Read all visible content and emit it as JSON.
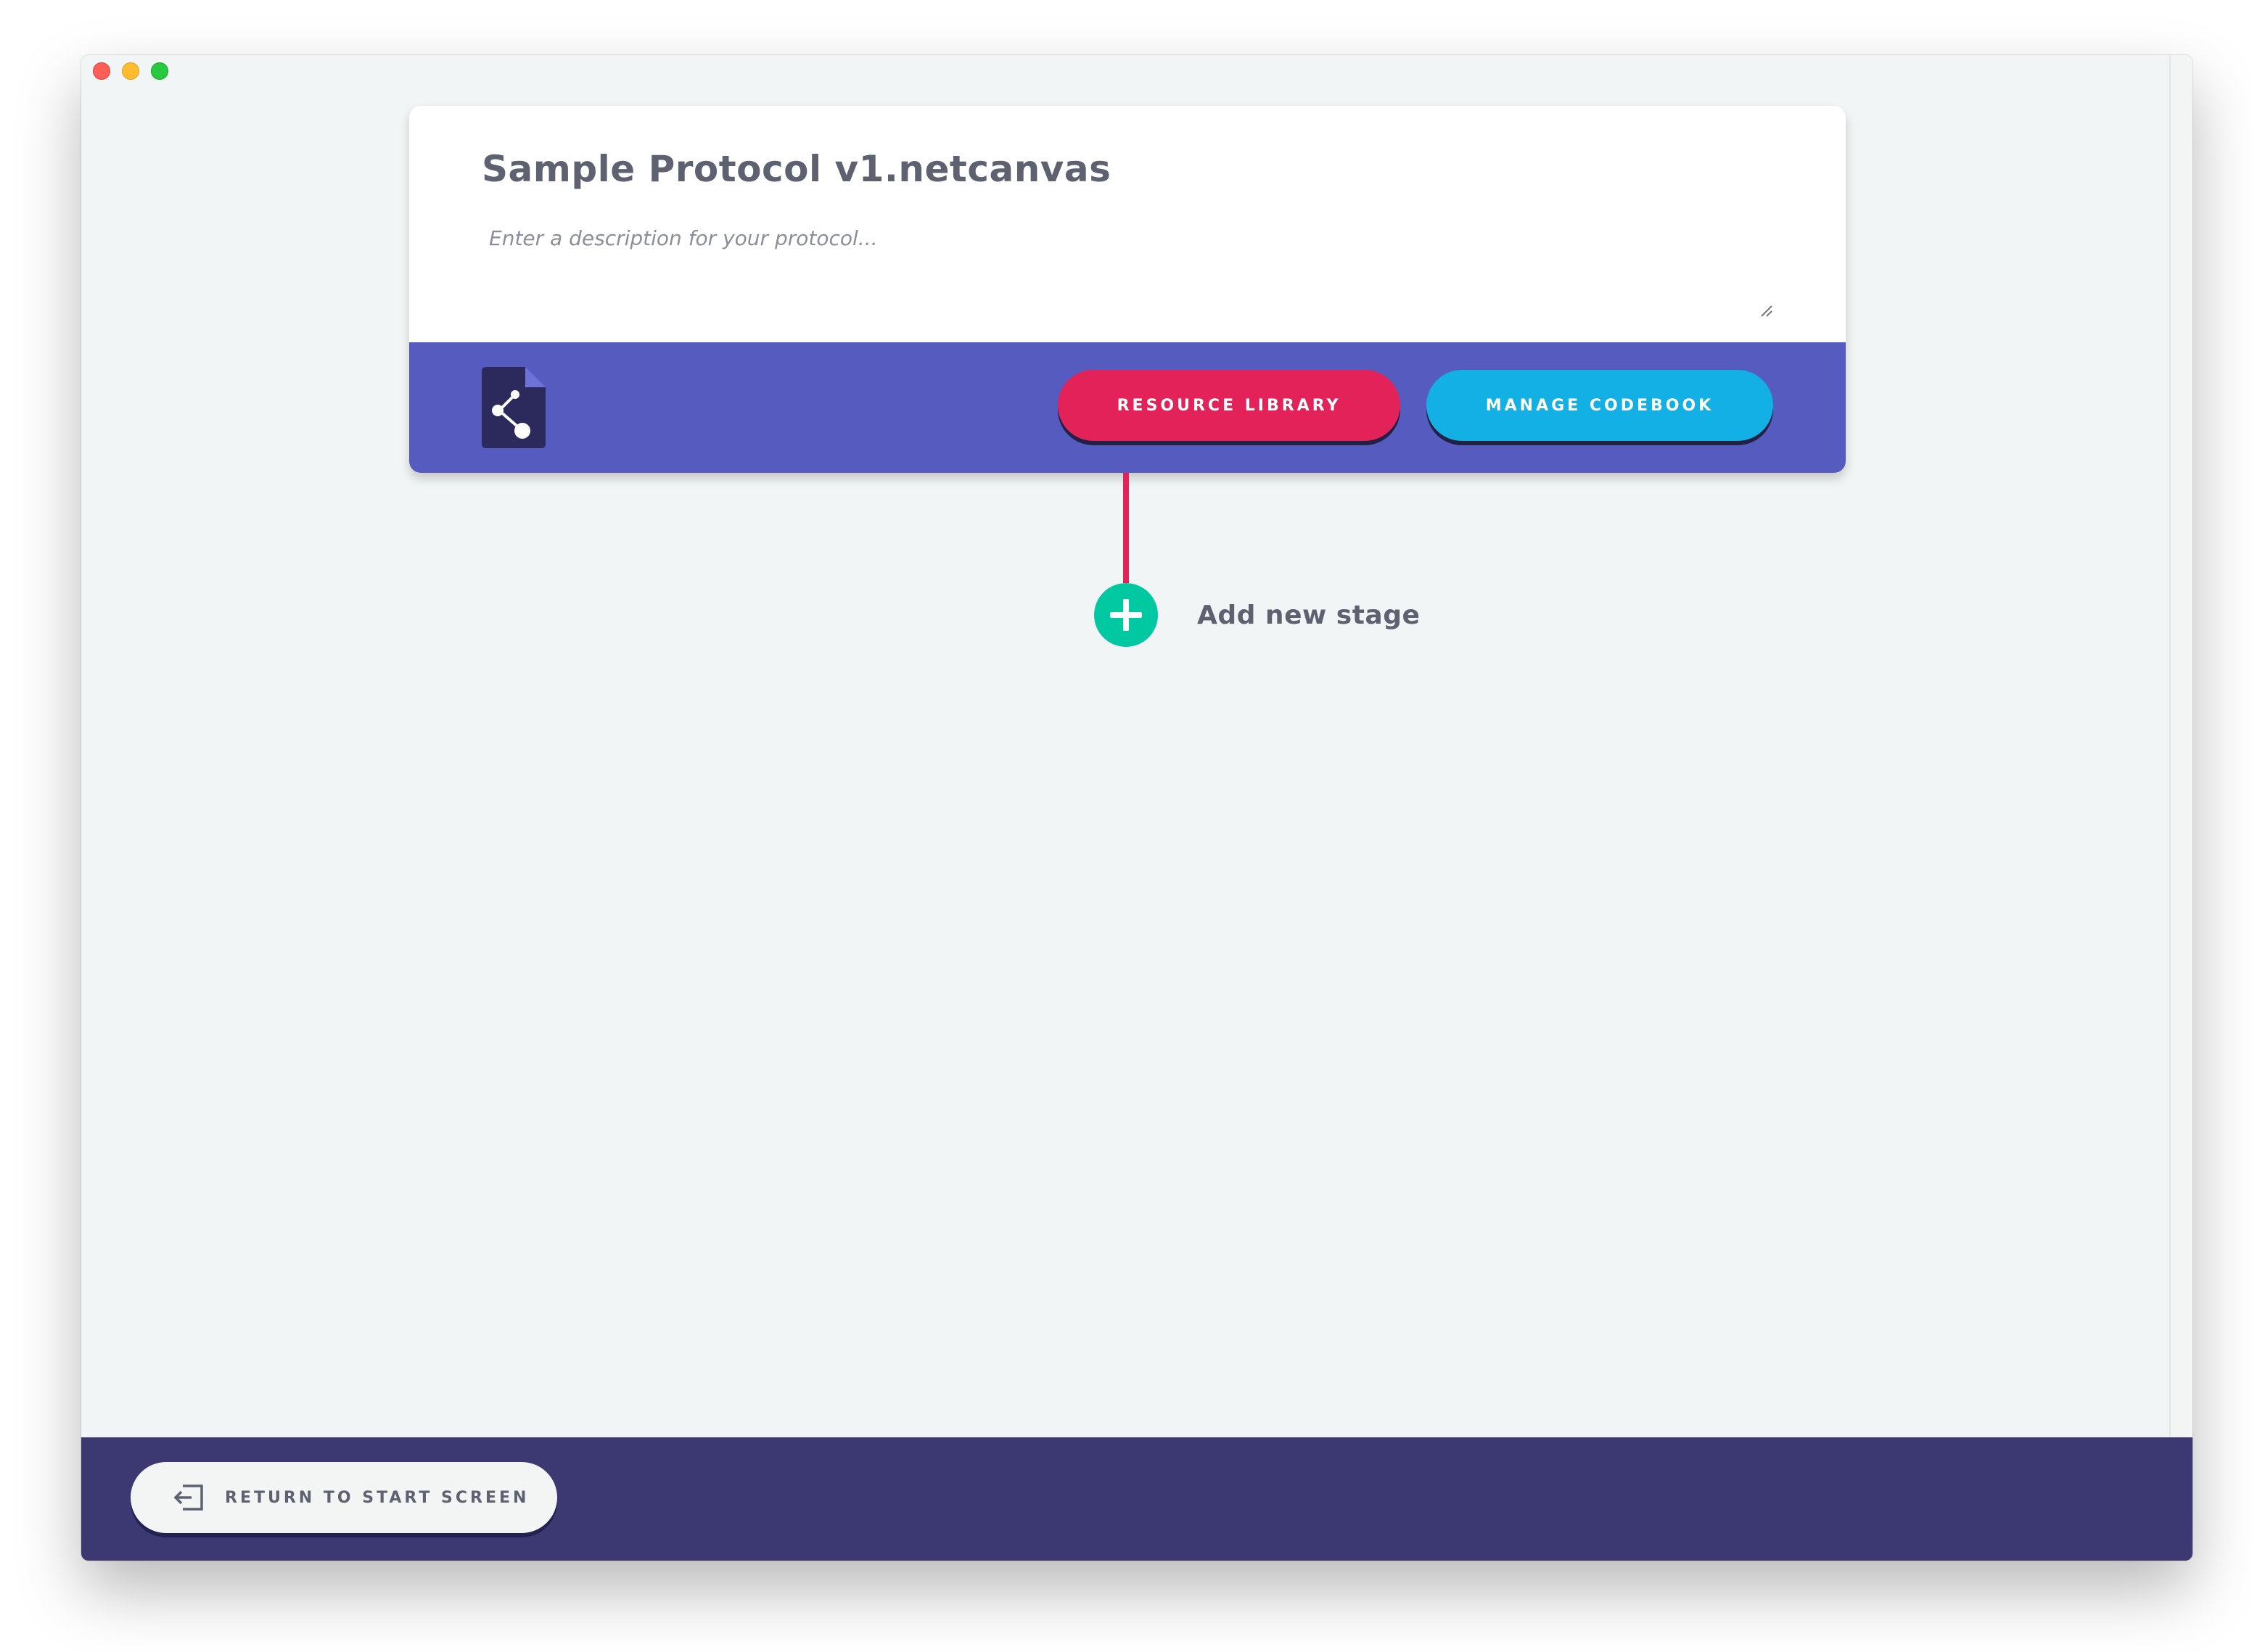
{
  "window": {
    "controls": [
      "close",
      "minimize",
      "maximize"
    ]
  },
  "protocol": {
    "title": "Sample Protocol v1.netcanvas",
    "description_placeholder": "Enter a description for your protocol...",
    "description_value": "",
    "file_icon": "protocol-file-share-icon"
  },
  "toolbar": {
    "resource_library_label": "RESOURCE LIBRARY",
    "manage_codebook_label": "MANAGE CODEBOOK"
  },
  "timeline": {
    "add_stage_label": "Add new stage",
    "add_icon": "plus-icon"
  },
  "footer": {
    "return_label": "RETURN TO START SCREEN",
    "return_icon": "exit-icon"
  },
  "colors": {
    "background": "#f2f5f5",
    "card_bar": "#565cbf",
    "resource_button": "#e3225a",
    "codebook_button": "#12b0e4",
    "add_stage": "#00c9a2",
    "footer": "#3b3872",
    "text": "#5d6170"
  }
}
